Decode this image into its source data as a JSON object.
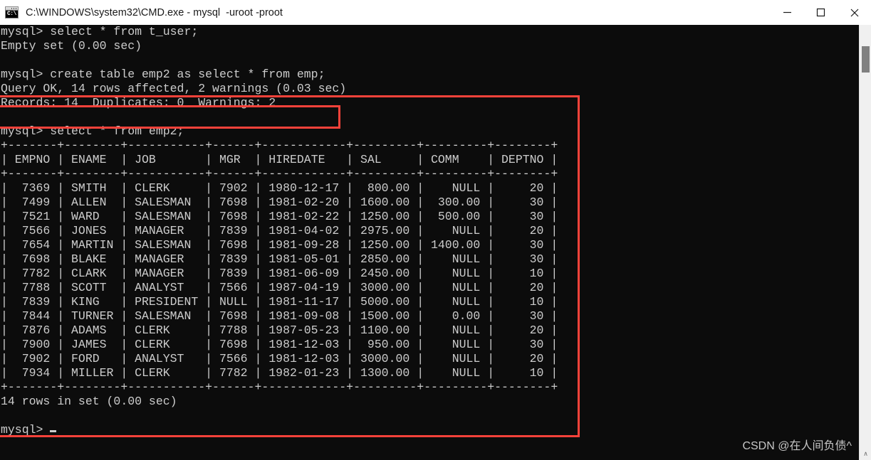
{
  "window": {
    "title": "C:\\WINDOWS\\system32\\CMD.exe - mysql  -uroot -proot",
    "icon": "cmd-console-icon",
    "icon_glyph": "C:\\",
    "controls": {
      "minimize_label": "—",
      "maximize_label": "☐",
      "close_label": "✕"
    }
  },
  "theme": {
    "console_bg": "#0c0c0c",
    "console_fg": "#cccccc",
    "annotation_red": "#f9423a",
    "titlebar_bg": "#ffffff",
    "scrollbar_track": "#f0f0f0",
    "scrollbar_thumb": "#808080"
  },
  "console": {
    "lines": [
      "mysql> select * from t_user;",
      "Empty set (0.00 sec)",
      "",
      "mysql> create table emp2 as select * from emp;",
      "Query OK, 14 rows affected, 2 warnings (0.03 sec)",
      "Records: 14  Duplicates: 0  Warnings: 2",
      "",
      "mysql> select * from emp2;",
      "+-------+--------+-----------+------+------------+---------+---------+--------+",
      "| EMPNO | ENAME  | JOB       | MGR  | HIREDATE   | SAL     | COMM    | DEPTNO |",
      "+-------+--------+-----------+------+------------+---------+---------+--------+",
      "|  7369 | SMITH  | CLERK     | 7902 | 1980-12-17 |  800.00 |    NULL |     20 |",
      "|  7499 | ALLEN  | SALESMAN  | 7698 | 1981-02-20 | 1600.00 |  300.00 |     30 |",
      "|  7521 | WARD   | SALESMAN  | 7698 | 1981-02-22 | 1250.00 |  500.00 |     30 |",
      "|  7566 | JONES  | MANAGER   | 7839 | 1981-04-02 | 2975.00 |    NULL |     20 |",
      "|  7654 | MARTIN | SALESMAN  | 7698 | 1981-09-28 | 1250.00 | 1400.00 |     30 |",
      "|  7698 | BLAKE  | MANAGER   | 7839 | 1981-05-01 | 2850.00 |    NULL |     30 |",
      "|  7782 | CLARK  | MANAGER   | 7839 | 1981-06-09 | 2450.00 |    NULL |     10 |",
      "|  7788 | SCOTT  | ANALYST   | 7566 | 1987-04-19 | 3000.00 |    NULL |     20 |",
      "|  7839 | KING   | PRESIDENT | NULL | 1981-11-17 | 5000.00 |    NULL |     10 |",
      "|  7844 | TURNER | SALESMAN  | 7698 | 1981-09-08 | 1500.00 |    0.00 |     30 |",
      "|  7876 | ADAMS  | CLERK     | 7788 | 1987-05-23 | 1100.00 |    NULL |     20 |",
      "|  7900 | JAMES  | CLERK     | 7698 | 1981-12-03 |  950.00 |    NULL |     30 |",
      "|  7902 | FORD   | ANALYST   | 7566 | 1981-12-03 | 3000.00 |    NULL |     20 |",
      "|  7934 | MILLER | CLERK     | 7782 | 1982-01-23 | 1300.00 |    NULL |     10 |",
      "+-------+--------+-----------+------+------------+---------+---------+--------+",
      "14 rows in set (0.00 sec)",
      "",
      "mysql>"
    ],
    "prompt": "mysql>"
  },
  "result_table": {
    "columns": [
      "EMPNO",
      "ENAME",
      "JOB",
      "MGR",
      "HIREDATE",
      "SAL",
      "COMM",
      "DEPTNO"
    ],
    "rows": [
      [
        "7369",
        "SMITH",
        "CLERK",
        "7902",
        "1980-12-17",
        "800.00",
        "NULL",
        "20"
      ],
      [
        "7499",
        "ALLEN",
        "SALESMAN",
        "7698",
        "1981-02-20",
        "1600.00",
        "300.00",
        "30"
      ],
      [
        "7521",
        "WARD",
        "SALESMAN",
        "7698",
        "1981-02-22",
        "1250.00",
        "500.00",
        "30"
      ],
      [
        "7566",
        "JONES",
        "MANAGER",
        "7839",
        "1981-04-02",
        "2975.00",
        "NULL",
        "20"
      ],
      [
        "7654",
        "MARTIN",
        "SALESMAN",
        "7698",
        "1981-09-28",
        "1250.00",
        "1400.00",
        "30"
      ],
      [
        "7698",
        "BLAKE",
        "MANAGER",
        "7839",
        "1981-05-01",
        "2850.00",
        "NULL",
        "30"
      ],
      [
        "7782",
        "CLARK",
        "MANAGER",
        "7839",
        "1981-06-09",
        "2450.00",
        "NULL",
        "10"
      ],
      [
        "7788",
        "SCOTT",
        "ANALYST",
        "7566",
        "1987-04-19",
        "3000.00",
        "NULL",
        "20"
      ],
      [
        "7839",
        "KING",
        "PRESIDENT",
        "NULL",
        "1981-11-17",
        "5000.00",
        "NULL",
        "10"
      ],
      [
        "7844",
        "TURNER",
        "SALESMAN",
        "7698",
        "1981-09-08",
        "1500.00",
        "0.00",
        "30"
      ],
      [
        "7876",
        "ADAMS",
        "CLERK",
        "7788",
        "1987-05-23",
        "1100.00",
        "NULL",
        "20"
      ],
      [
        "7900",
        "JAMES",
        "CLERK",
        "7698",
        "1981-12-03",
        "950.00",
        "NULL",
        "30"
      ],
      [
        "7902",
        "FORD",
        "ANALYST",
        "7566",
        "1981-12-03",
        "3000.00",
        "NULL",
        "20"
      ],
      [
        "7934",
        "MILLER",
        "CLERK",
        "7782",
        "1982-01-23",
        "1300.00",
        "NULL",
        "10"
      ]
    ],
    "row_count_status": "14 rows in set (0.00 sec)"
  },
  "commands": [
    "select * from t_user;",
    "create table emp2 as select * from emp;",
    "select * from emp2;"
  ],
  "messages": {
    "empty_set": "Empty set (0.00 sec)",
    "query_ok": "Query OK, 14 rows affected, 2 warnings (0.03 sec)",
    "records": "Records: 14  Duplicates: 0  Warnings: 2",
    "rows_in_set": "14 rows in set (0.00 sec)"
  },
  "annotations": [
    {
      "name": "highlight-region-outer",
      "label": ""
    },
    {
      "name": "highlight-command-inner",
      "label": ""
    }
  ],
  "scrollbar": {
    "down_arrow": "∧"
  },
  "watermark": "CSDN @在人间负债^"
}
